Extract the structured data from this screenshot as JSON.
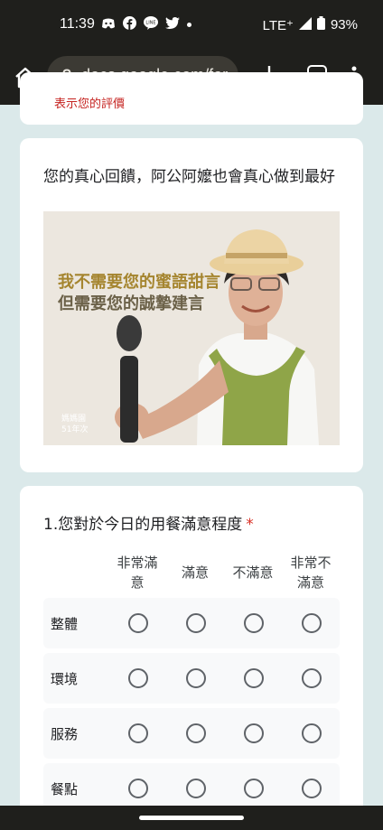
{
  "status": {
    "time": "11:39",
    "network": "LTE⁺",
    "battery": "93%"
  },
  "browser": {
    "url": "docs.google.com/for"
  },
  "form": {
    "cut_text": "表示您的評價",
    "section_title": "您的真心回饋，阿公阿嬤也會真心做到最好",
    "image_text": {
      "line1": "我不需要您的蜜語甜言",
      "line2": "但需要您的誠摯建言",
      "apron": "不老夢想 125號",
      "logo": "媽媽園 51年次"
    },
    "question": {
      "title": "1.您對於今日的用餐滿意程度",
      "required": "*",
      "columns": [
        "非常滿意",
        "滿意",
        "不滿意",
        "非常不滿意"
      ],
      "columns_display": [
        "非常滿\n意",
        "滿意",
        "不滿意",
        "非常不\n滿意"
      ],
      "rows": [
        "整體",
        "環境",
        "服務",
        "餐點"
      ]
    }
  }
}
